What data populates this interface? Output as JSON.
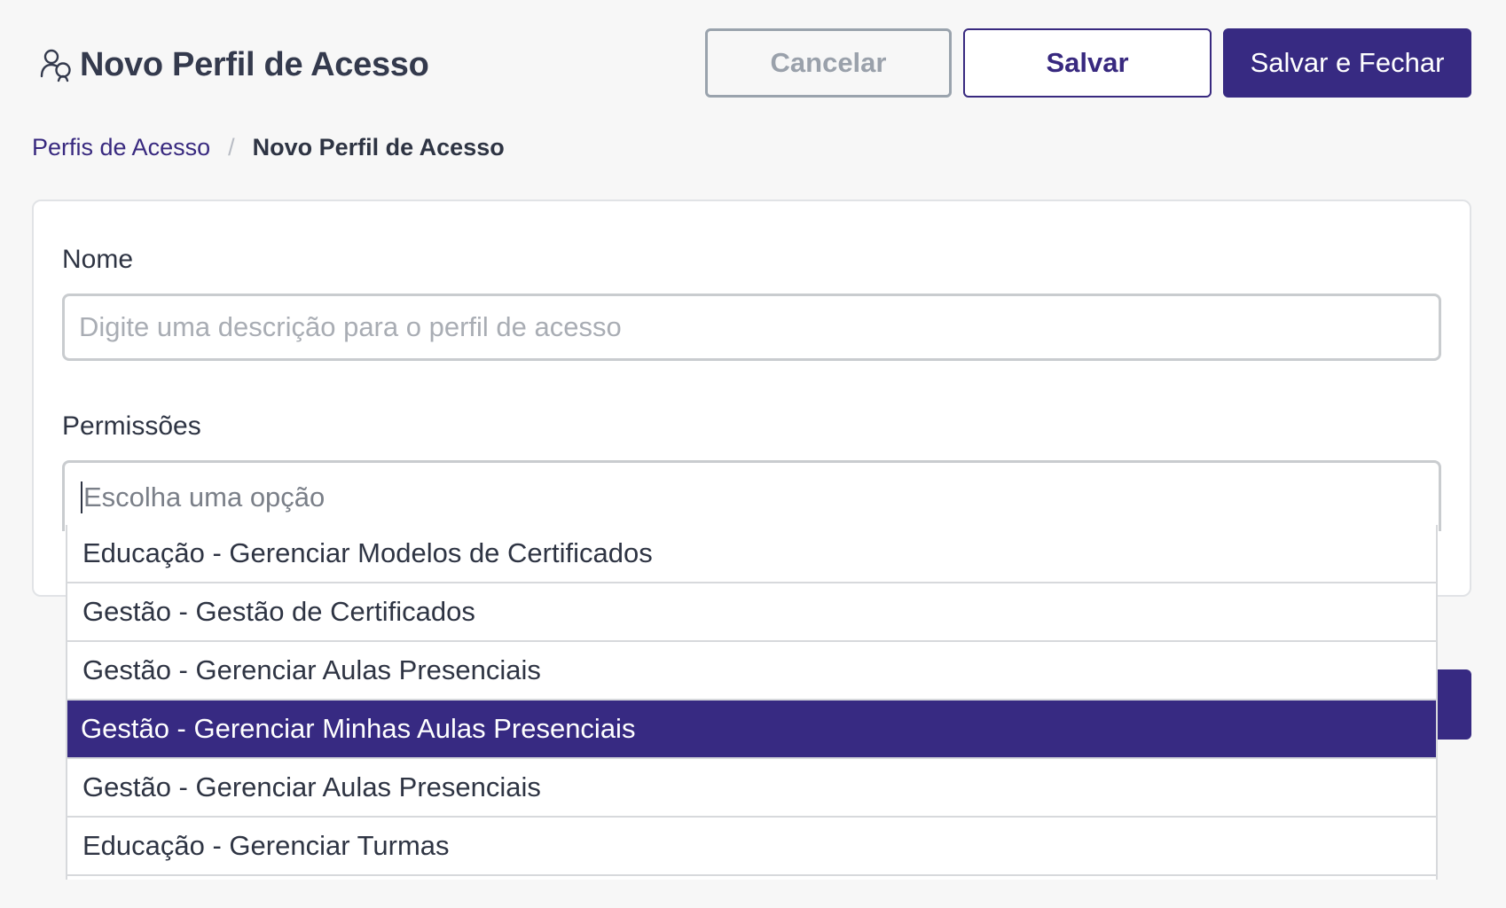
{
  "header": {
    "title": "Novo Perfil de Acesso",
    "icon": "users-icon"
  },
  "toolbar": {
    "cancel_label": "Cancelar",
    "save_label": "Salvar",
    "save_close_label": "Salvar e Fechar"
  },
  "breadcrumb": {
    "parent": "Perfis de Acesso",
    "separator": "/",
    "current": "Novo Perfil de Acesso"
  },
  "form": {
    "name_label": "Nome",
    "name_value": "",
    "name_placeholder": "Digite uma descrição para o perfil de acesso",
    "permissions_label": "Permissões",
    "permissions_placeholder": "Escolha uma opção"
  },
  "dropdown": {
    "options": [
      "Educação - Gerenciar Modelos de Certificados",
      "Gestão - Gestão de Certificados",
      "Gestão - Gerenciar Aulas Presenciais",
      "Gestão - Gerenciar Minhas Aulas Presenciais",
      "Gestão - Gerenciar Aulas Presenciais",
      "Educação - Gerenciar Turmas"
    ],
    "highlighted_index": 3
  },
  "colors": {
    "brand": "#372a82",
    "background": "#f7f7f7",
    "border": "#c9cccf"
  }
}
